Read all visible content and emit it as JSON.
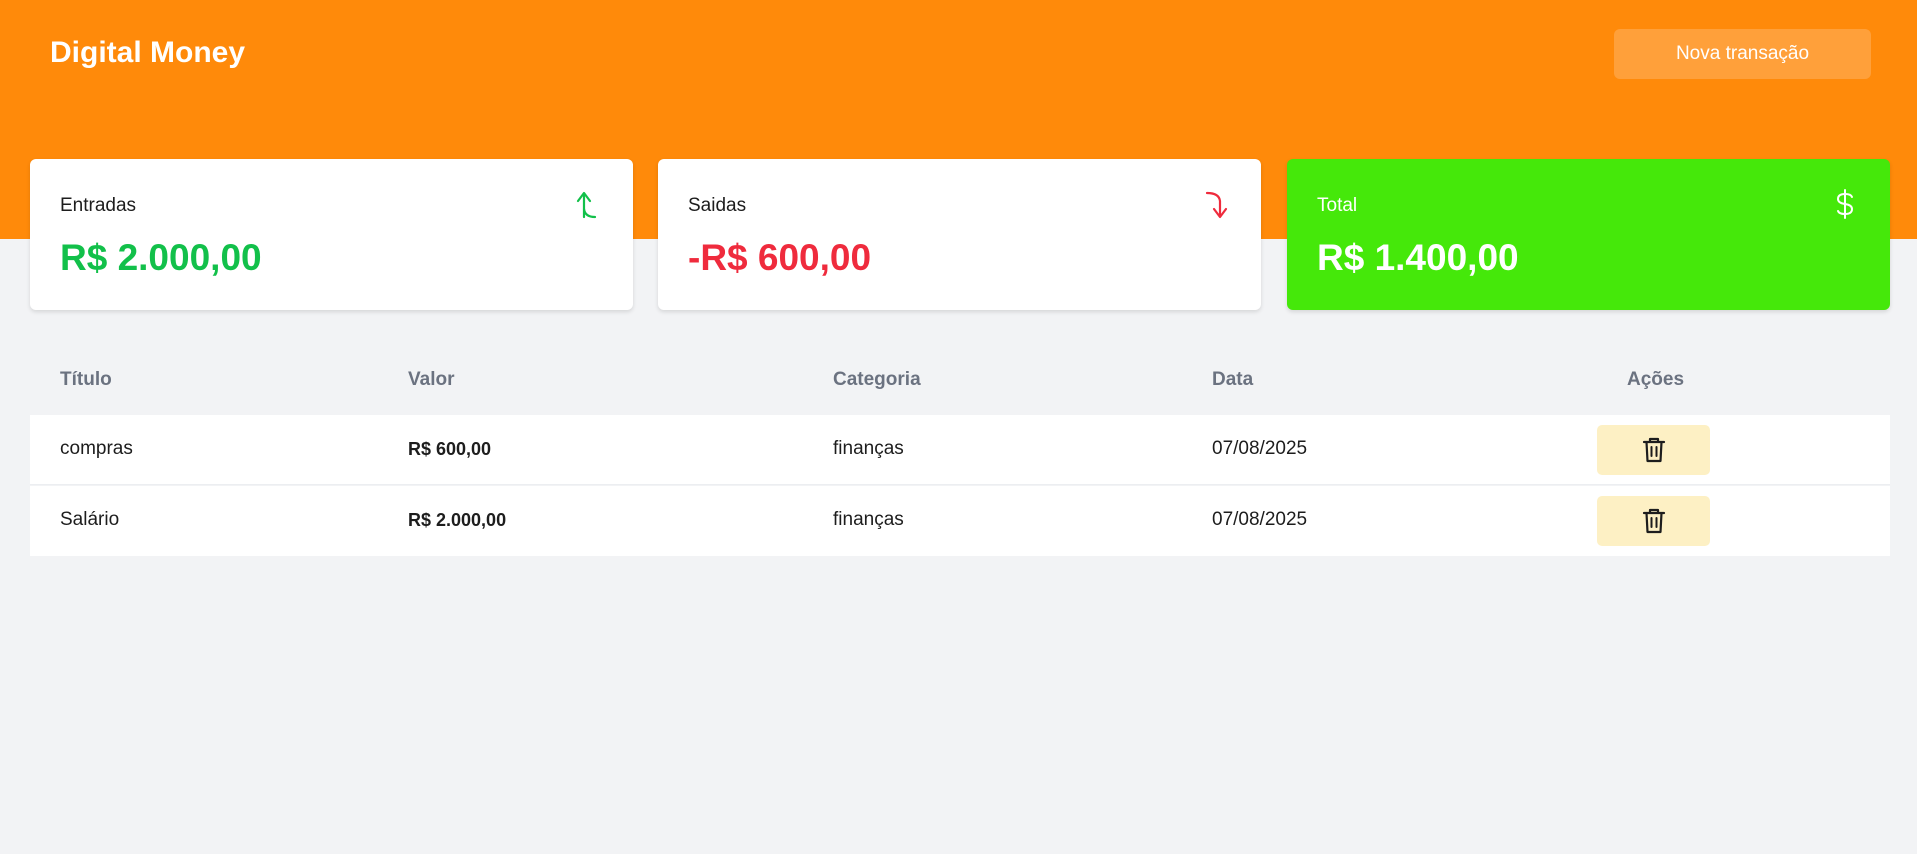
{
  "header": {
    "brand": "Digital Money",
    "new_transaction_label": "Nova transação"
  },
  "summary": [
    {
      "label": "Entradas",
      "value": "R$ 2.000,00",
      "icon": "arrow-up-icon",
      "color": "#12c04a"
    },
    {
      "label": "Saidas",
      "value": "-R$ 600,00",
      "icon": "arrow-down-icon",
      "color": "#ef2b3d"
    },
    {
      "label": "Total",
      "value": "R$ 1.400,00",
      "icon": "dollar-icon",
      "color": "#45e80a"
    }
  ],
  "table": {
    "columns": [
      "Título",
      "Valor",
      "Categoria",
      "Data",
      "Ações"
    ],
    "rows": [
      {
        "title": "compras",
        "value": "R$ 600,00",
        "type": "expense",
        "category": "finanças",
        "date": "07/08/2025"
      },
      {
        "title": "Salário",
        "value": "R$ 2.000,00",
        "type": "income",
        "category": "finanças",
        "date": "07/08/2025"
      }
    ]
  },
  "colors": {
    "header": "#ff8a0a",
    "income": "#12c04a",
    "expense": "#ef2b3d",
    "delete_button": "#fdf0c4"
  }
}
